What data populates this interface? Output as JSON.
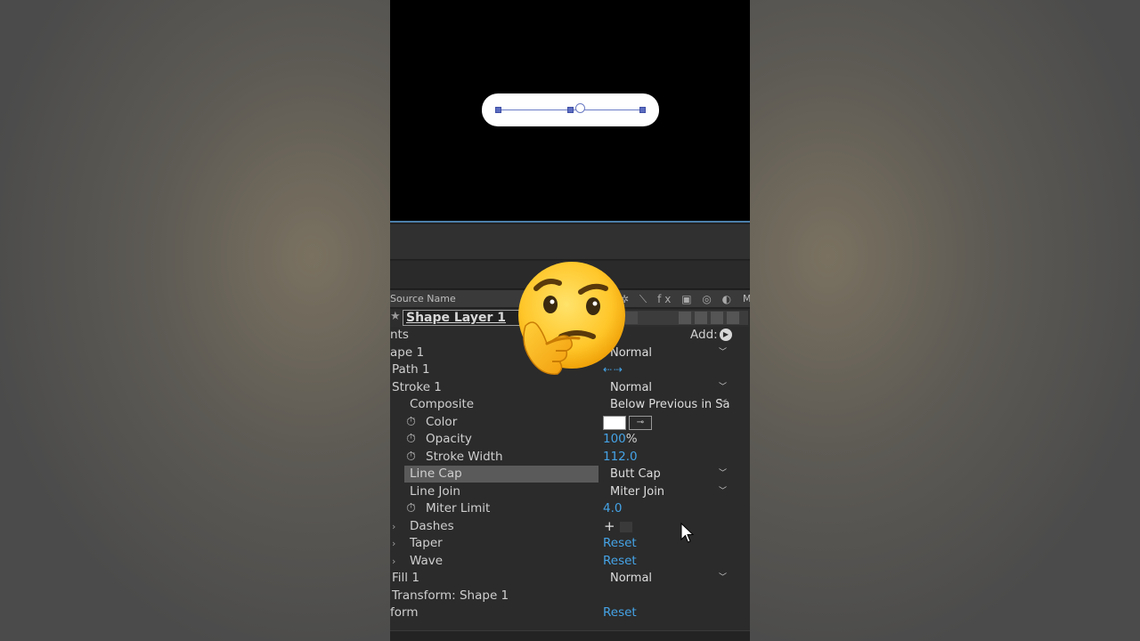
{
  "timeline": {
    "header": {
      "source_name": "Source Name",
      "switch_icons": "✲ ⟍ fx ▣ ◎ ◐ ⊙",
      "mode_col": "M"
    },
    "layer": {
      "name": "Shape Layer 1"
    },
    "rows": [
      {
        "id": "contents",
        "label": "nts",
        "add_label": "Add:"
      },
      {
        "id": "shape1",
        "label": "ape 1",
        "value": "Normal"
      },
      {
        "id": "path1",
        "label": "Path 1"
      },
      {
        "id": "stroke1",
        "label": "Stroke 1",
        "value": "Normal"
      },
      {
        "id": "composite",
        "label": "Composite",
        "value": "Below Previous in Sa"
      },
      {
        "id": "color",
        "label": "Color",
        "swatch_color": "#ffffff"
      },
      {
        "id": "opacity",
        "label": "Opacity",
        "value": "100",
        "unit": "%"
      },
      {
        "id": "stroke_width",
        "label": "Stroke Width",
        "value": "112.0"
      },
      {
        "id": "line_cap",
        "label": "Line Cap",
        "value": "Butt Cap"
      },
      {
        "id": "line_join",
        "label": "Line Join",
        "value": "Miter Join"
      },
      {
        "id": "miter_limit",
        "label": "Miter Limit",
        "value": "4.0"
      },
      {
        "id": "dashes",
        "label": "Dashes"
      },
      {
        "id": "taper",
        "label": "Taper",
        "value": "Reset"
      },
      {
        "id": "wave",
        "label": "Wave",
        "value": "Reset"
      },
      {
        "id": "fill1",
        "label": "Fill 1",
        "value": "Normal"
      },
      {
        "id": "transform_shape",
        "label": "Transform: Shape 1"
      },
      {
        "id": "transform",
        "label": "form",
        "value": "Reset"
      }
    ]
  },
  "colors": {
    "accent_value": "#45a3e6",
    "highlight_row": "#5a5a5a",
    "viewer_bg": "#000000",
    "stroke_preview": "#ffffff"
  },
  "overlay": {
    "emoji_icon": "thinking-face-icon"
  }
}
